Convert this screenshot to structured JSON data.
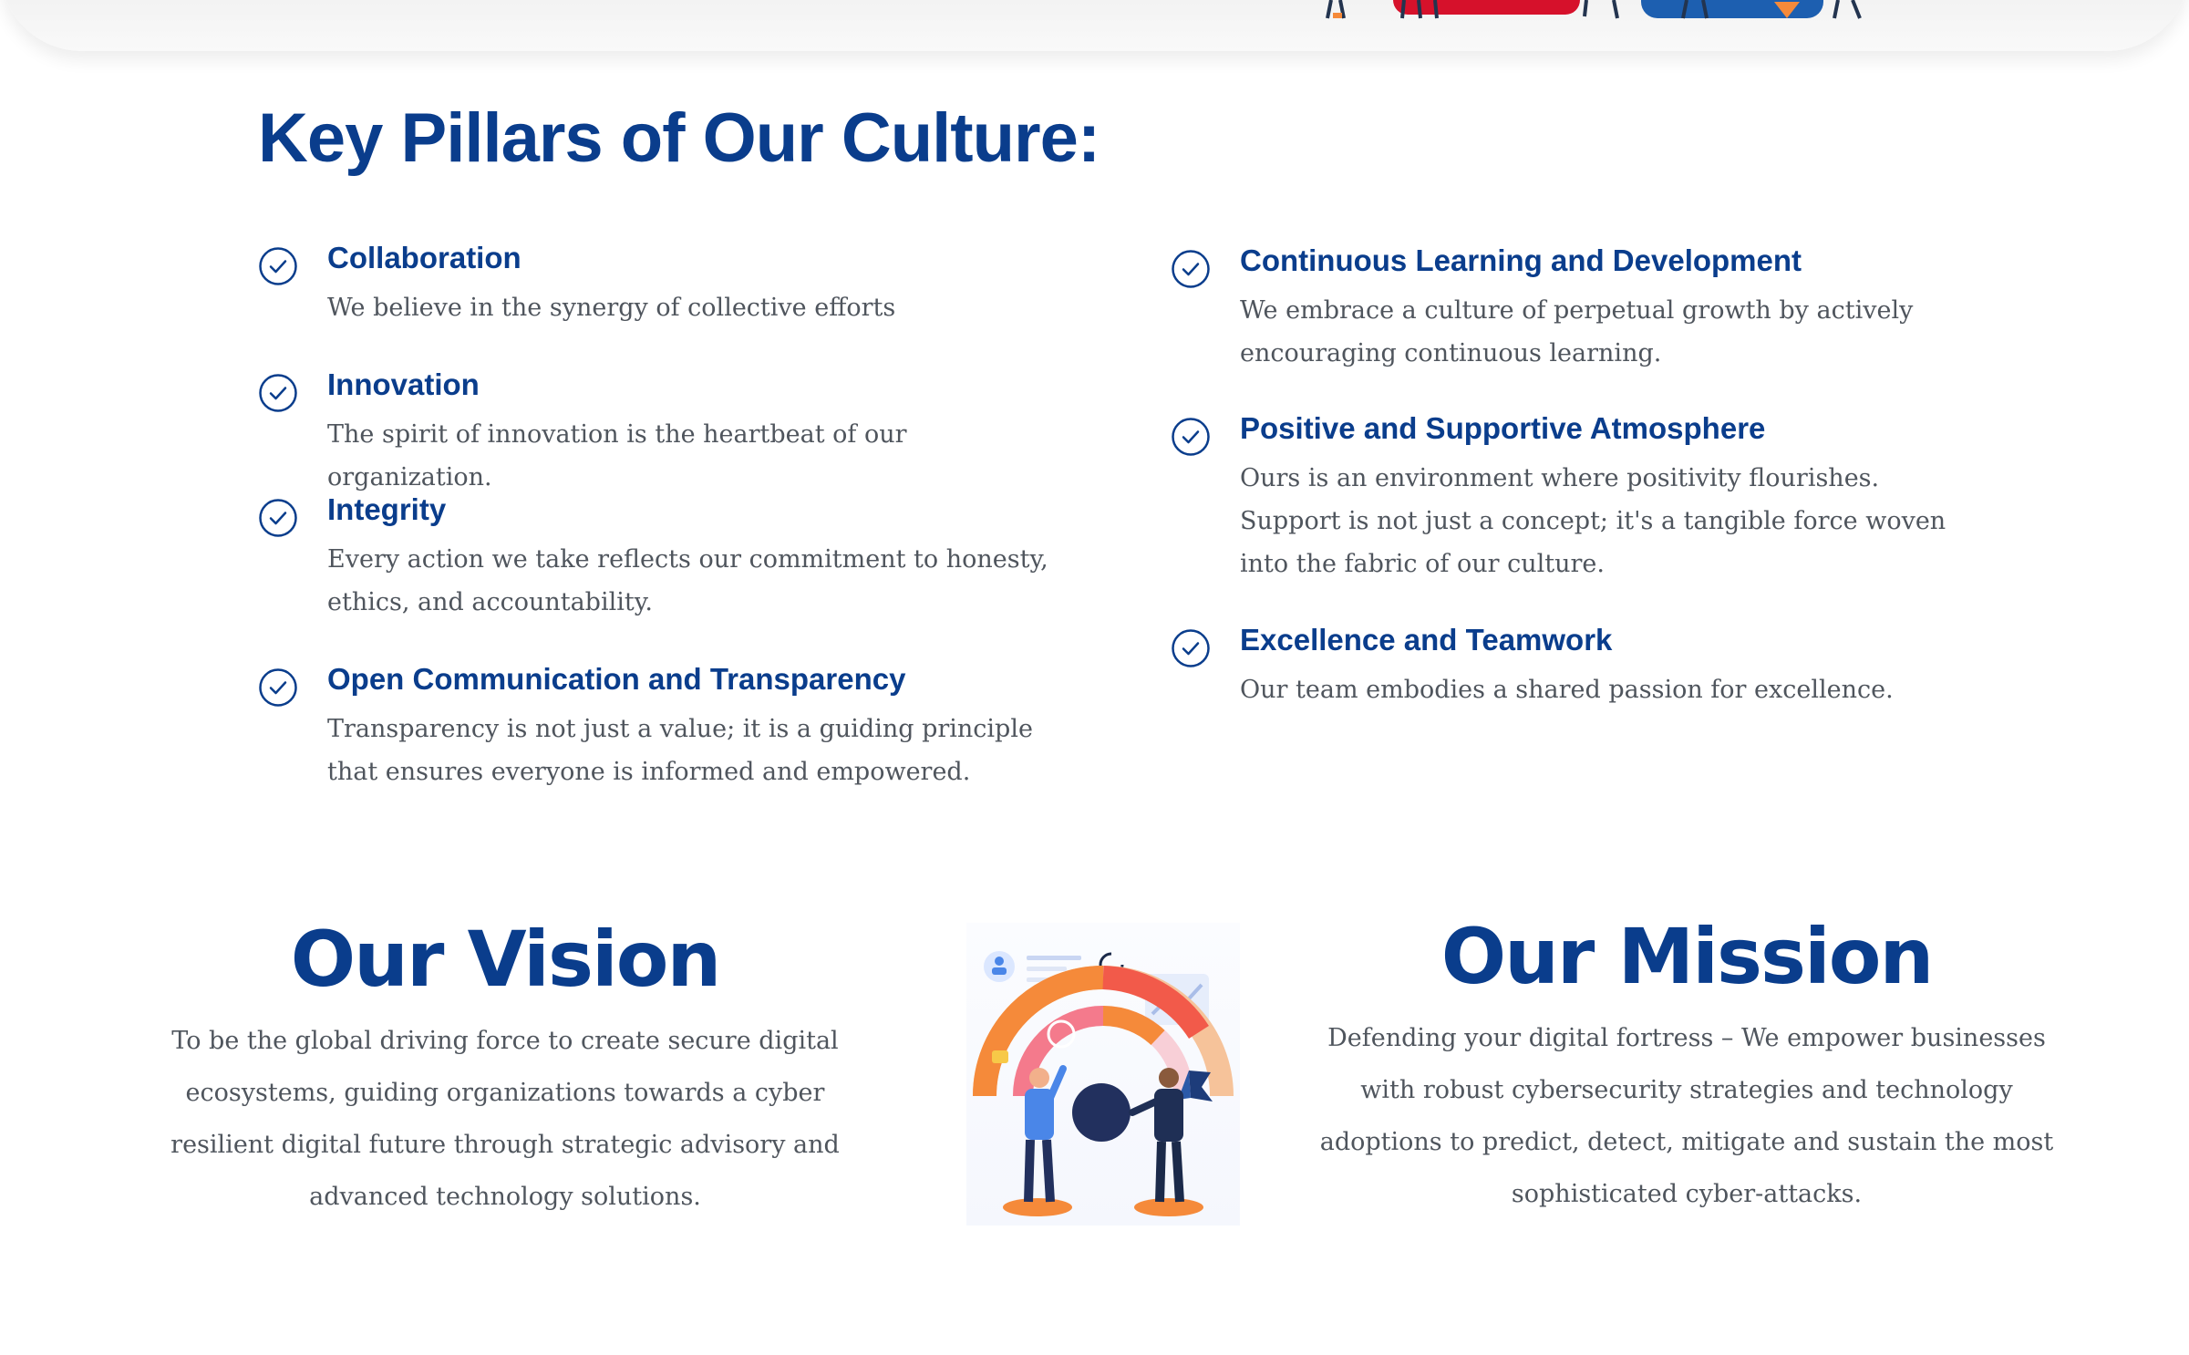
{
  "culture": {
    "title": "Key Pillars of Our Culture:",
    "left_pillars": [
      {
        "title": "Collaboration",
        "description": "We believe in the synergy of collective efforts"
      },
      {
        "title": "Innovation",
        "description": "The spirit of innovation is the heartbeat of our organization."
      },
      {
        "title": "Integrity",
        "description": "Every action we take reflects our commitment to honesty, ethics, and accountability."
      },
      {
        "title": "Open Communication and Transparency",
        "description": "Transparency is not just a value; it is a guiding principle that ensures everyone is informed and empowered."
      }
    ],
    "right_pillars": [
      {
        "title": "Continuous Learning and Development",
        "description": "We embrace a culture of perpetual growth by actively encouraging continuous learning."
      },
      {
        "title": "Positive and Supportive Atmosphere",
        "description": "Ours is an environment where positivity flourishes. Support is not just a concept; it's a tangible force woven into the fabric of our culture."
      },
      {
        "title": "Excellence and Teamwork",
        "description": "Our team embodies a shared passion for excellence."
      }
    ],
    "check_icon": "check-circle-icon"
  },
  "vision": {
    "title": "Our Vision",
    "text": "To be the global driving force to create secure digital ecosystems, guiding organizations towards a cyber resilient digital future through strategic advisory and advanced technology solutions."
  },
  "mission": {
    "title": "Our Mission",
    "text": "Defending your digital fortress – We empower businesses with robust cybersecurity strategies and technology adoptions to predict, detect, mitigate and sustain the most sophisticated cyber-attacks."
  },
  "colors": {
    "heading_blue": "#0a3d8c",
    "body_text": "#4f555d",
    "accent_orange": "#f58a3a",
    "accent_red": "#d6112b",
    "accent_blue": "#1d5fb0"
  }
}
